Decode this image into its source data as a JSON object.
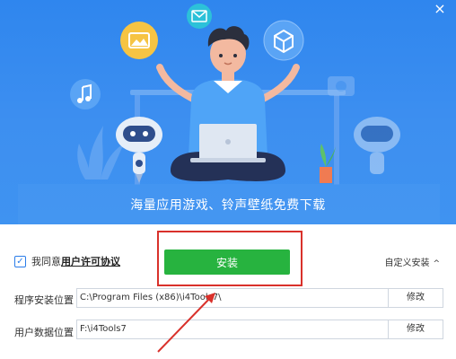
{
  "window": {
    "close_glyph": "×"
  },
  "banner": {
    "slogan": "海量应用游戏、铃声壁纸免费下载",
    "icons": [
      "image-icon",
      "mail-icon",
      "cube-icon",
      "music-note-icon",
      "camera-icon"
    ]
  },
  "install": {
    "agree_prefix": "我同意",
    "agree_link": "用户许可协议",
    "checked": true,
    "install_label": "安装",
    "custom_install_label": "自定义安装",
    "custom_install_caret": "^"
  },
  "fields": {
    "program_label": "程序安装位置",
    "program_path": "C:\\Program Files (x86)\\i4Tools7\\",
    "program_modify": "修改",
    "data_label": "用户数据位置",
    "data_path": "F:\\i4Tools7",
    "data_modify": "修改"
  },
  "colors": {
    "banner_blue": "#3d8ff0",
    "install_green": "#27b33f",
    "highlight_red": "#d9312b",
    "accent_blue": "#2b7de9"
  }
}
